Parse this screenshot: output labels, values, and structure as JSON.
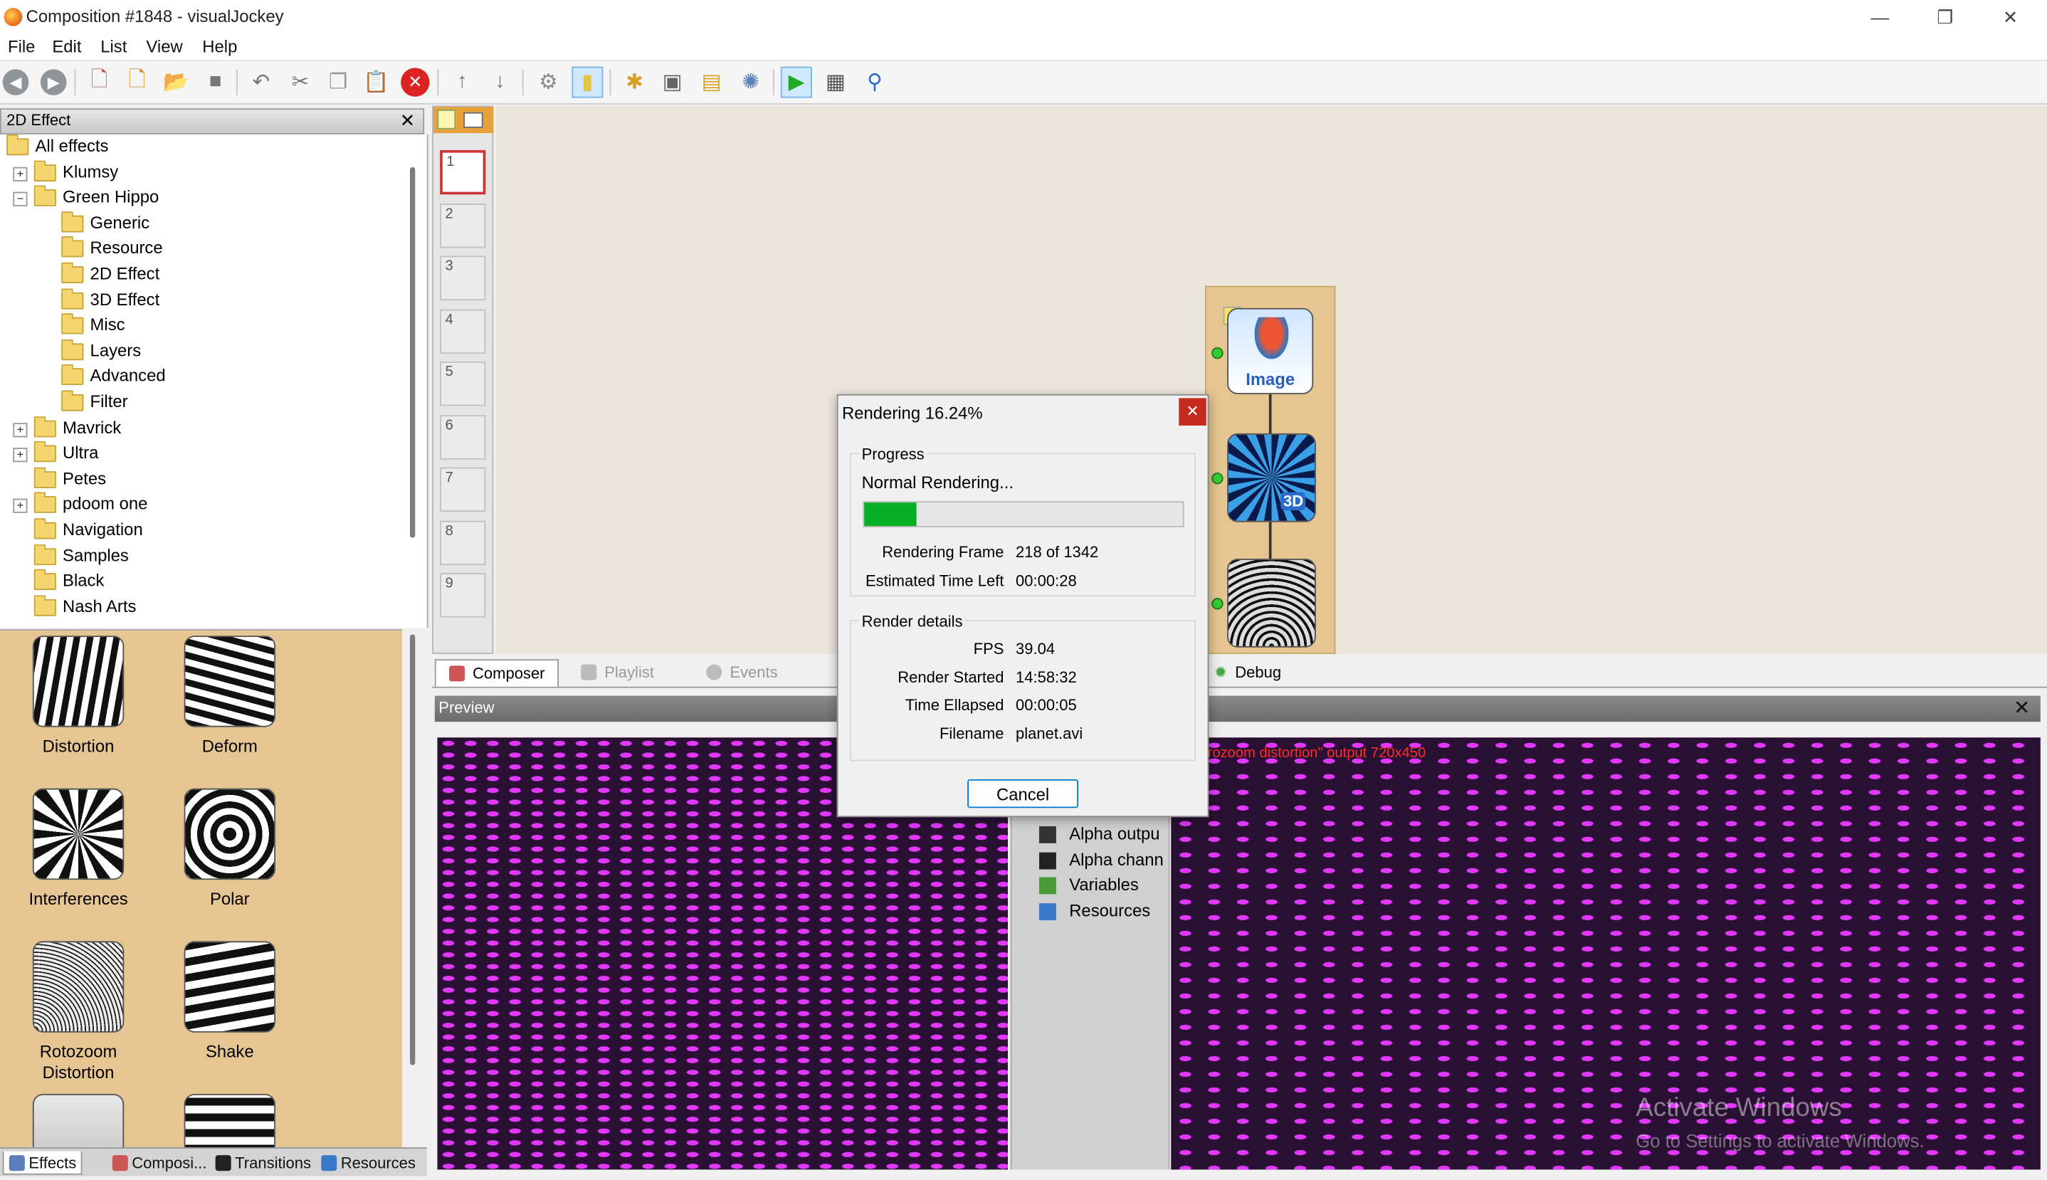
{
  "window": {
    "title": "Composition #1848 - visualJockey",
    "controls": [
      "—",
      "❐",
      "✕"
    ]
  },
  "menu": [
    "File",
    "Edit",
    "List",
    "View",
    "Help"
  ],
  "left_panel": {
    "title": "2D Effect",
    "close": "✕",
    "tree": [
      {
        "label": "All effects",
        "level": 0,
        "expander": ""
      },
      {
        "label": "Klumsy",
        "level": 1,
        "expander": "+"
      },
      {
        "label": "Green Hippo",
        "level": 1,
        "expander": "−"
      },
      {
        "label": "Generic",
        "level": 2,
        "expander": ""
      },
      {
        "label": "Resource",
        "level": 2,
        "expander": ""
      },
      {
        "label": "2D Effect",
        "level": 2,
        "expander": ""
      },
      {
        "label": "3D Effect",
        "level": 2,
        "expander": ""
      },
      {
        "label": "Misc",
        "level": 2,
        "expander": ""
      },
      {
        "label": "Layers",
        "level": 2,
        "expander": ""
      },
      {
        "label": "Advanced",
        "level": 2,
        "expander": ""
      },
      {
        "label": "Filter",
        "level": 2,
        "expander": ""
      },
      {
        "label": "Mavrick",
        "level": 1,
        "expander": "+"
      },
      {
        "label": "Ultra",
        "level": 1,
        "expander": "+"
      },
      {
        "label": "Petes",
        "level": 1,
        "expander": ""
      },
      {
        "label": "pdoom one",
        "level": 1,
        "expander": "+"
      },
      {
        "label": "Navigation",
        "level": 1,
        "expander": ""
      },
      {
        "label": "Samples",
        "level": 1,
        "expander": ""
      },
      {
        "label": "Black",
        "level": 1,
        "expander": ""
      },
      {
        "label": "Nash Arts",
        "level": 1,
        "expander": ""
      }
    ],
    "effects": [
      {
        "label": "Distortion",
        "style": "waves"
      },
      {
        "label": "Deform",
        "style": "deform"
      },
      {
        "label": "Interferences",
        "style": "interf"
      },
      {
        "label": "Polar",
        "style": "polar"
      },
      {
        "label": "Rotozoom\nDistortion",
        "style": "roto"
      },
      {
        "label": "Shake",
        "style": "shake"
      },
      {
        "label": "",
        "style": "green"
      },
      {
        "label": "",
        "style": "hbars"
      }
    ],
    "bottom_tabs": [
      "Effects",
      "Composi...",
      "Transitions",
      "Resources"
    ]
  },
  "layers": [
    "1",
    "2",
    "3",
    "4",
    "5",
    "6",
    "7",
    "8",
    "9"
  ],
  "nodes": {
    "image_label": "Image",
    "badge_3d": "3D"
  },
  "composer_tabs": [
    "Composer",
    "Playlist",
    "Events",
    "Debug"
  ],
  "preview": {
    "title": "Preview",
    "close": "✕",
    "overlay_text": "rozoom distortion\" output 720x450",
    "list": [
      "Alpha outpu",
      "Alpha chann",
      "Variables",
      "Resources"
    ],
    "watermark_title": "Activate Windows",
    "watermark_sub": "Go to Settings to activate Windows."
  },
  "dialog": {
    "title": "Rendering 16.24%",
    "close": "✕",
    "progress_group": "Progress",
    "status": "Normal Rendering...",
    "progress_fraction": 0.1624,
    "rows_progress": [
      {
        "label": "Rendering Frame",
        "value": "218 of 1342"
      },
      {
        "label": "Estimated Time Left",
        "value": "00:00:28"
      }
    ],
    "details_group": "Render details",
    "rows_details": [
      {
        "label": "FPS",
        "value": "39.04"
      },
      {
        "label": "Render Started",
        "value": "14:58:32"
      },
      {
        "label": "Time Ellapsed",
        "value": "00:00:05"
      },
      {
        "label": "Filename",
        "value": "planet.avi"
      }
    ],
    "cancel": "Cancel"
  },
  "colors": {
    "progress_fill": "#06b025",
    "gallery_bg": "#e5c591",
    "preview_purple": "#e238ff",
    "close_red": "#c42b1c"
  }
}
